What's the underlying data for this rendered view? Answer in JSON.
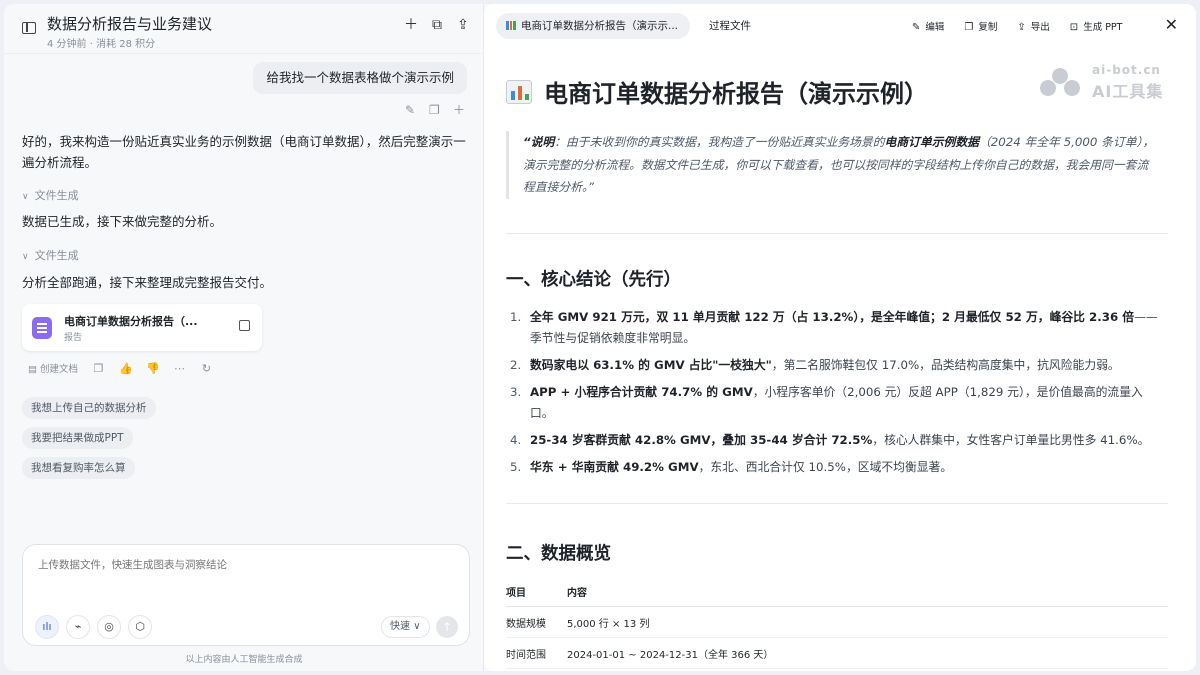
{
  "left": {
    "title": "数据分析报告与业务建议",
    "meta": "4 分钟前 · 消耗 28 积分",
    "user_message": "给我找一个数据表格做个演示示例",
    "assistant_intro": "好的，我来构造一份贴近真实业务的示例数据（电商订单数据），然后完整演示一遍分析流程。",
    "step1": "文件生成",
    "assistant_mid": "数据已生成，接下来做完整的分析。",
    "step2": "文件生成",
    "assistant_end": "分析全部跑通，接下来整理成完整报告交付。",
    "doc_card": {
      "name": "电商订单数据分析报告（...",
      "type": "报告"
    },
    "create_doc": "创建文档",
    "suggestions": [
      "我想上传自己的数据分析",
      "我要把结果做成PPT",
      "我想看复购率怎么算"
    ],
    "input_placeholder": "上传数据文件，快速生成图表与洞察结论",
    "mode": "快速",
    "disclaimer": "以上内容由人工智能生成合成"
  },
  "right": {
    "tab_active": "电商订单数据分析报告（演示示...",
    "tab_process": "过程文件",
    "tools": {
      "edit": "编辑",
      "copy": "复制",
      "export": "导出",
      "ppt": "生成 PPT"
    },
    "watermark": {
      "url": "ai-bot.cn",
      "name": "AI工具集"
    },
    "report_title": "电商订单数据分析报告（演示示例）",
    "quote": {
      "lead": "“说明",
      "p1": "：由于未收到你的真实数据，我构造了一份贴近真实业务场景的",
      "bold": "电商订单示例数据",
      "p2": "（2024 年全年 5,000 条订单），演示完整的分析流程。数据文件已生成，你可以下载查看，也可以按同样的字段结构上传你自己的数据，我会用同一套流程直接分析。”"
    },
    "section1": "一、核心结论（先行）",
    "conclusions": [
      {
        "num": "1.",
        "bold": "全年 GMV 921 万元，双 11 单月贡献 122 万（占 13.2%），是全年峰值；2 月最低仅 52 万，峰谷比 2.36 倍",
        "rest": "——季节性与促销依赖度非常明显。"
      },
      {
        "num": "2.",
        "bold": "数码家电以 63.1% 的 GMV 占比\"一枝独大\"",
        "rest": "，第二名服饰鞋包仅 17.0%，品类结构高度集中，抗风险能力弱。"
      },
      {
        "num": "3.",
        "bold": "APP + 小程序合计贡献 74.7% 的 GMV",
        "rest": "，小程序客单价（2,006 元）反超 APP（1,829 元），是价值最高的流量入口。"
      },
      {
        "num": "4.",
        "bold": "25-34 岁客群贡献 42.8% GMV，叠加 35-44 岁合计 72.5%",
        "rest": "，核心人群集中，女性客户订单量比男性多 41.6%。"
      },
      {
        "num": "5.",
        "bold": "华东 + 华南贡献 49.2% GMV",
        "rest": "，东北、西北合计仅 10.5%，区域不均衡显著。"
      }
    ],
    "section2": "二、数据概览",
    "table": {
      "headers": [
        "项目",
        "内容"
      ],
      "rows": [
        [
          "数据规模",
          "5,000 行 × 13 列"
        ],
        [
          "时间范围",
          "2024-01-01 ~ 2024-12-31（全年 366 天）"
        ]
      ]
    }
  }
}
